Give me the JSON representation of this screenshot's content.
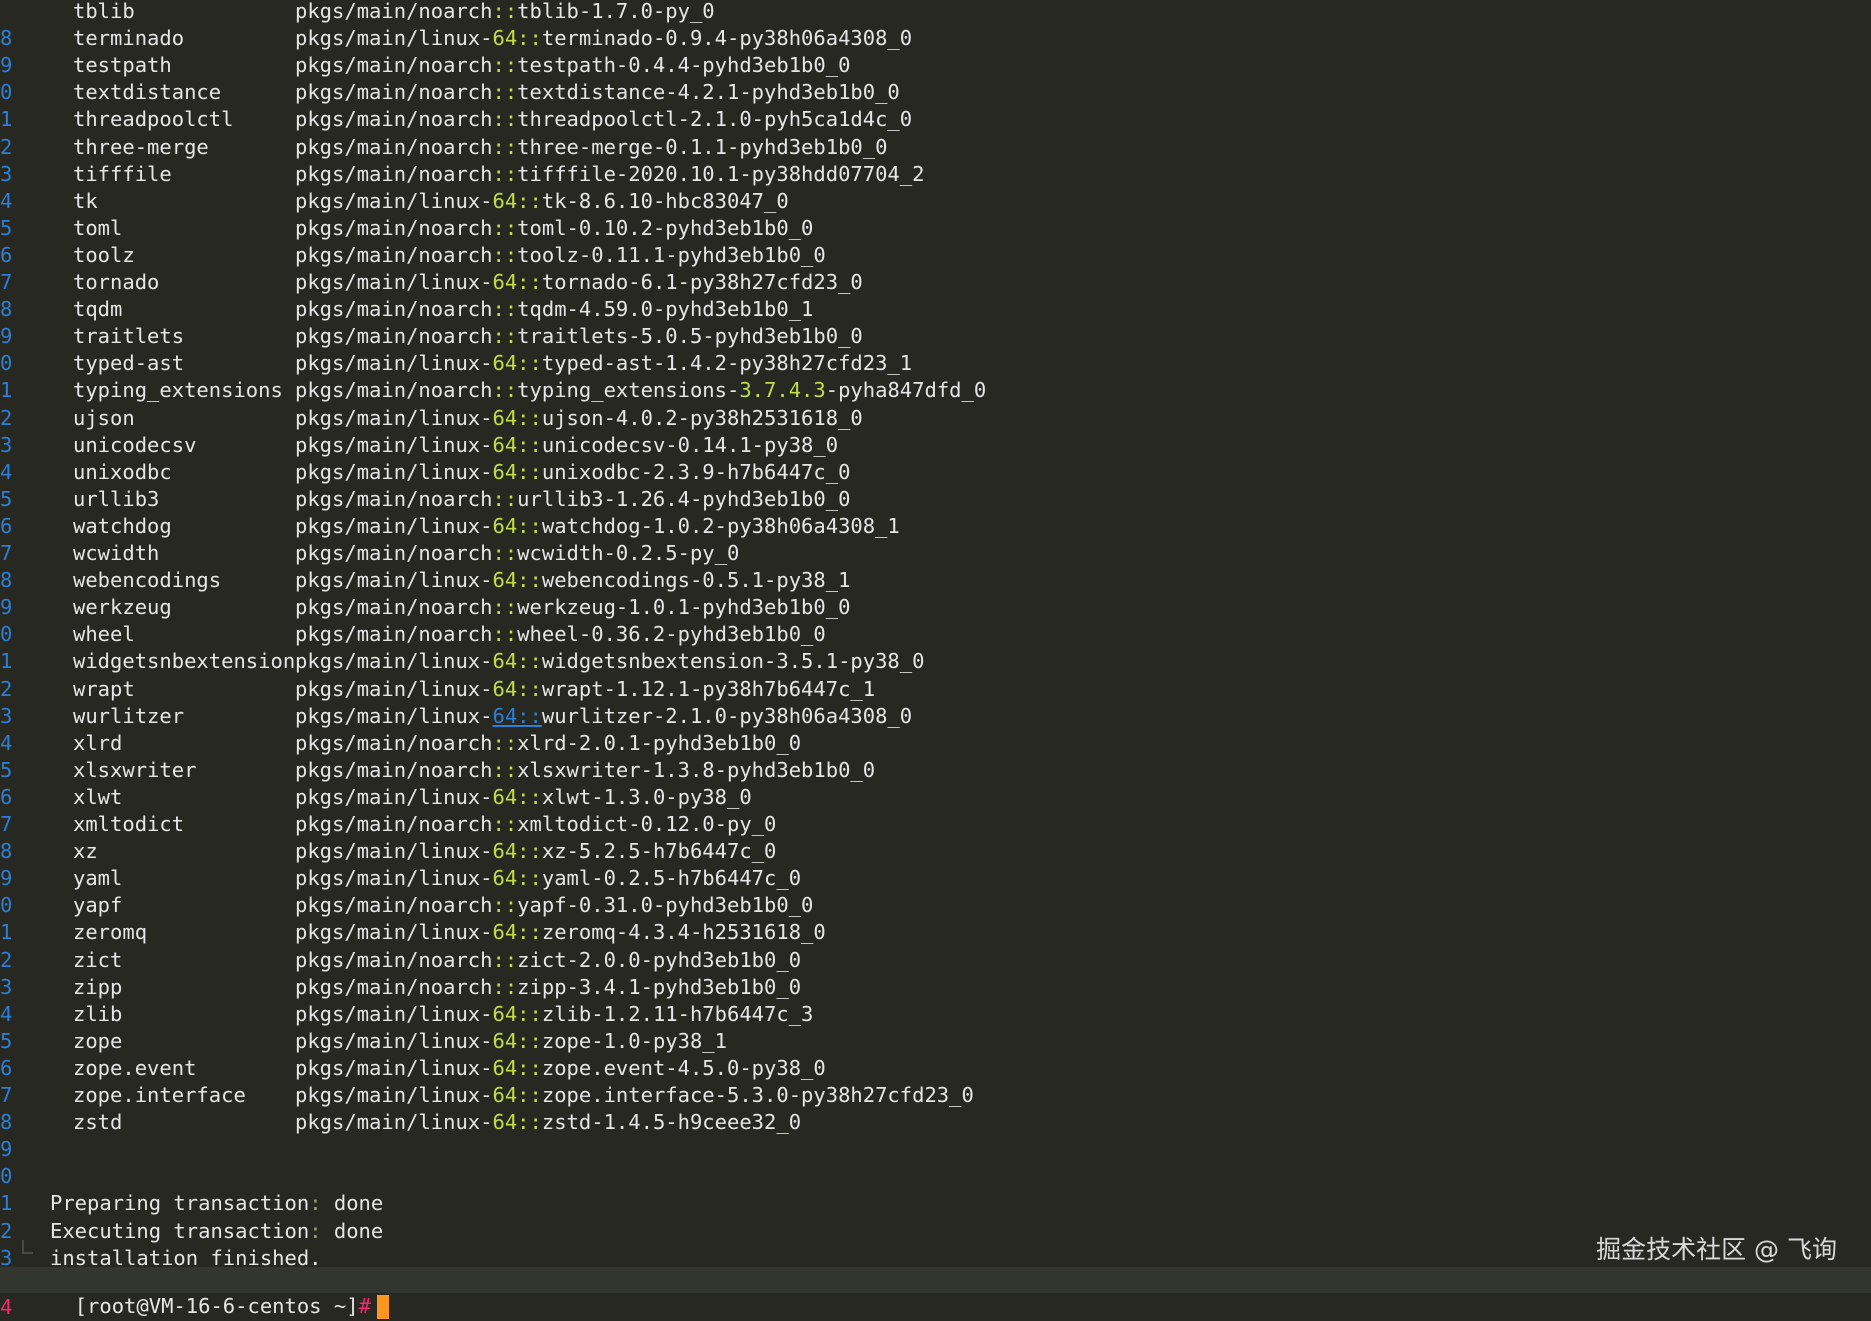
{
  "packages": [
    {
      "gutter": "",
      "name": "tblib",
      "channel": "pkgs/main/noarch",
      "sep": "::",
      "spec": "tblib-1.7.0-py_0"
    },
    {
      "gutter": "8",
      "name": "terminado",
      "channel": "pkgs/main/linux-",
      "arch": "64",
      "sep": "::",
      "spec": "terminado-0.9.4-py38h06a4308_0"
    },
    {
      "gutter": "9",
      "name": "testpath",
      "channel": "pkgs/main/noarch",
      "sep": "::",
      "spec": "testpath-0.4.4-pyhd3eb1b0_0"
    },
    {
      "gutter": "0",
      "name": "textdistance",
      "channel": "pkgs/main/noarch",
      "sep": "::",
      "spec": "textdistance-4.2.1-pyhd3eb1b0_0"
    },
    {
      "gutter": "1",
      "name": "threadpoolctl",
      "channel": "pkgs/main/noarch",
      "sep": "::",
      "spec": "threadpoolctl-2.1.0-pyh5ca1d4c_0"
    },
    {
      "gutter": "2",
      "name": "three-merge",
      "channel": "pkgs/main/noarch",
      "sep": "::",
      "spec": "three-merge-0.1.1-pyhd3eb1b0_0"
    },
    {
      "gutter": "3",
      "name": "tifffile",
      "channel": "pkgs/main/noarch",
      "sep": "::",
      "spec": "tifffile-2020.10.1-py38hdd07704_2"
    },
    {
      "gutter": "4",
      "name": "tk",
      "channel": "pkgs/main/linux-",
      "arch": "64",
      "sep": "::",
      "spec": "tk-8.6.10-hbc83047_0"
    },
    {
      "gutter": "5",
      "name": "toml",
      "channel": "pkgs/main/noarch",
      "sep": "::",
      "spec": "toml-0.10.2-pyhd3eb1b0_0"
    },
    {
      "gutter": "6",
      "name": "toolz",
      "channel": "pkgs/main/noarch",
      "sep": "::",
      "spec": "toolz-0.11.1-pyhd3eb1b0_0"
    },
    {
      "gutter": "7",
      "name": "tornado",
      "channel": "pkgs/main/linux-",
      "arch": "64",
      "sep": "::",
      "spec": "tornado-6.1-py38h27cfd23_0"
    },
    {
      "gutter": "8",
      "name": "tqdm",
      "channel": "pkgs/main/noarch",
      "sep": "::",
      "spec": "tqdm-4.59.0-pyhd3eb1b0_1"
    },
    {
      "gutter": "9",
      "name": "traitlets",
      "channel": "pkgs/main/noarch",
      "sep": "::",
      "spec": "traitlets-5.0.5-pyhd3eb1b0_0"
    },
    {
      "gutter": "0",
      "name": "typed-ast",
      "channel": "pkgs/main/linux-",
      "arch": "64",
      "sep": "::",
      "spec": "typed-ast-1.4.2-py38h27cfd23_1"
    },
    {
      "gutter": "1",
      "name": "typing_extensions",
      "channel": "pkgs/main/noarch",
      "sep": "::",
      "spec": "typing_extensions-3.7.4.3-pyha847dfd_0"
    },
    {
      "gutter": "2",
      "name": "ujson",
      "channel": "pkgs/main/linux-",
      "arch": "64",
      "sep": "::",
      "spec": "ujson-4.0.2-py38h2531618_0"
    },
    {
      "gutter": "3",
      "name": "unicodecsv",
      "channel": "pkgs/main/linux-",
      "arch": "64",
      "sep": "::",
      "spec": "unicodecsv-0.14.1-py38_0"
    },
    {
      "gutter": "4",
      "name": "unixodbc",
      "channel": "pkgs/main/linux-",
      "arch": "64",
      "sep": "::",
      "spec": "unixodbc-2.3.9-h7b6447c_0"
    },
    {
      "gutter": "5",
      "name": "urllib3",
      "channel": "pkgs/main/noarch",
      "sep": "::",
      "spec": "urllib3-1.26.4-pyhd3eb1b0_0"
    },
    {
      "gutter": "6",
      "name": "watchdog",
      "channel": "pkgs/main/linux-",
      "arch": "64",
      "sep": "::",
      "spec": "watchdog-1.0.2-py38h06a4308_1"
    },
    {
      "gutter": "7",
      "name": "wcwidth",
      "channel": "pkgs/main/noarch",
      "sep": "::",
      "spec": "wcwidth-0.2.5-py_0"
    },
    {
      "gutter": "8",
      "name": "webencodings",
      "channel": "pkgs/main/linux-",
      "arch": "64",
      "sep": "::",
      "spec": "webencodings-0.5.1-py38_1"
    },
    {
      "gutter": "9",
      "name": "werkzeug",
      "channel": "pkgs/main/noarch",
      "sep": "::",
      "spec": "werkzeug-1.0.1-pyhd3eb1b0_0"
    },
    {
      "gutter": "0",
      "name": "wheel",
      "channel": "pkgs/main/noarch",
      "sep": "::",
      "spec": "wheel-0.36.2-pyhd3eb1b0_0"
    },
    {
      "gutter": "1",
      "name": "widgetsnbextension",
      "channel": "pkgs/main/linux-",
      "arch": "64",
      "sep": "::",
      "spec": "widgetsnbextension-3.5.1-py38_0"
    },
    {
      "gutter": "2",
      "name": "wrapt",
      "channel": "pkgs/main/linux-",
      "arch": "64",
      "sep": "::",
      "spec": "wrapt-1.12.1-py38h7b6447c_1"
    },
    {
      "gutter": "3",
      "name": "wurlitzer",
      "channel": "pkgs/main/linux-",
      "arch": "64",
      "sep": "::",
      "spec": "wurlitzer-2.1.0-py38h06a4308_0",
      "link": true
    },
    {
      "gutter": "4",
      "name": "xlrd",
      "channel": "pkgs/main/noarch",
      "sep": "::",
      "spec": "xlrd-2.0.1-pyhd3eb1b0_0"
    },
    {
      "gutter": "5",
      "name": "xlsxwriter",
      "channel": "pkgs/main/noarch",
      "sep": "::",
      "spec": "xlsxwriter-1.3.8-pyhd3eb1b0_0"
    },
    {
      "gutter": "6",
      "name": "xlwt",
      "channel": "pkgs/main/linux-",
      "arch": "64",
      "sep": "::",
      "spec": "xlwt-1.3.0-py38_0"
    },
    {
      "gutter": "7",
      "name": "xmltodict",
      "channel": "pkgs/main/noarch",
      "sep": "::",
      "spec": "xmltodict-0.12.0-py_0"
    },
    {
      "gutter": "8",
      "name": "xz",
      "channel": "pkgs/main/linux-",
      "arch": "64",
      "sep": "::",
      "spec": "xz-5.2.5-h7b6447c_0"
    },
    {
      "gutter": "9",
      "name": "yaml",
      "channel": "pkgs/main/linux-",
      "arch": "64",
      "sep": "::",
      "spec": "yaml-0.2.5-h7b6447c_0"
    },
    {
      "gutter": "0",
      "name": "yapf",
      "channel": "pkgs/main/noarch",
      "sep": "::",
      "spec": "yapf-0.31.0-pyhd3eb1b0_0"
    },
    {
      "gutter": "1",
      "name": "zeromq",
      "channel": "pkgs/main/linux-",
      "arch": "64",
      "sep": "::",
      "spec": "zeromq-4.3.4-h2531618_0"
    },
    {
      "gutter": "2",
      "name": "zict",
      "channel": "pkgs/main/noarch",
      "sep": "::",
      "spec": "zict-2.0.0-pyhd3eb1b0_0"
    },
    {
      "gutter": "3",
      "name": "zipp",
      "channel": "pkgs/main/noarch",
      "sep": "::",
      "spec": "zipp-3.4.1-pyhd3eb1b0_0"
    },
    {
      "gutter": "4",
      "name": "zlib",
      "channel": "pkgs/main/linux-",
      "arch": "64",
      "sep": "::",
      "spec": "zlib-1.2.11-h7b6447c_3"
    },
    {
      "gutter": "5",
      "name": "zope",
      "channel": "pkgs/main/linux-",
      "arch": "64",
      "sep": "::",
      "spec": "zope-1.0-py38_1"
    },
    {
      "gutter": "6",
      "name": "zope.event",
      "channel": "pkgs/main/linux-",
      "arch": "64",
      "sep": "::",
      "spec": "zope.event-4.5.0-py38_0"
    },
    {
      "gutter": "7",
      "name": "zope.interface",
      "channel": "pkgs/main/linux-",
      "arch": "64",
      "sep": "::",
      "spec": "zope.interface-5.3.0-py38h27cfd23_0"
    },
    {
      "gutter": "8",
      "name": "zstd",
      "channel": "pkgs/main/linux-",
      "arch": "64",
      "sep": "::",
      "spec": "zstd-1.4.5-h9ceee32_0"
    }
  ],
  "blank_gutters": [
    "9",
    "0"
  ],
  "messages": [
    {
      "gutter": "1",
      "label": "Preparing transaction",
      "colon": ":",
      "status": " done"
    },
    {
      "gutter": "2",
      "label": "Executing transaction",
      "colon": ":",
      "status": " done"
    },
    {
      "gutter": "3",
      "label": "installation finished.",
      "colon": "",
      "status": ""
    }
  ],
  "prompt": {
    "gutter": "4",
    "text": "[root@VM-16-6-centos ~]",
    "symbol": "#"
  },
  "watermark": "掘金技术社区 @ 飞询",
  "colors": {
    "background": "#272822",
    "arch": "#c0dd4a",
    "gutter": "#2c7fd6",
    "prompt_symbol": "#f92672",
    "cursor": "#fd971f"
  }
}
